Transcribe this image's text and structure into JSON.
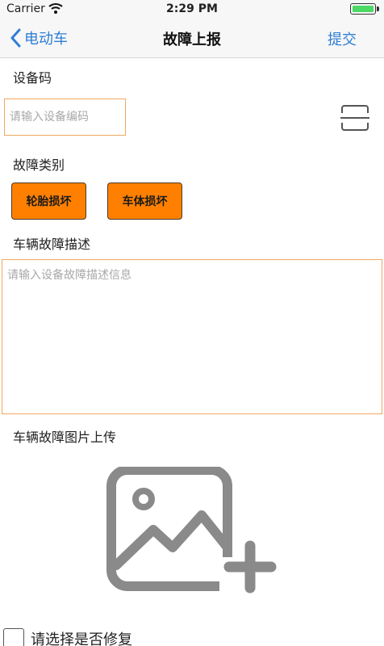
{
  "status_bar": {
    "carrier": "Carrier",
    "time": "2:29 PM",
    "battery_level": 1.0,
    "battery_color": "#4cd964"
  },
  "nav": {
    "back_label": "电动车",
    "back_icon": "chevron-left-icon",
    "title": "故障上报",
    "submit_label": "提交",
    "accent_color": "#2f7dd6"
  },
  "form": {
    "device_code_label": "设备码",
    "device_code_placeholder": "请输入设备编码",
    "device_code_value": "",
    "scan_icon": "scan-icon",
    "fault_type_label": "故障类别",
    "fault_types": [
      "轮胎损坏",
      "车体损坏"
    ],
    "fault_button_color": "#ff8000",
    "description_label": "车辆故障描述",
    "description_placeholder": "请输入设备故障描述信息",
    "description_value": "",
    "photo_label": "车辆故障图片上传",
    "photo_icon": "add-image-icon",
    "repair_label": "请选择是否修复",
    "repair_checked": false,
    "field_border_color": "#f0a860"
  }
}
